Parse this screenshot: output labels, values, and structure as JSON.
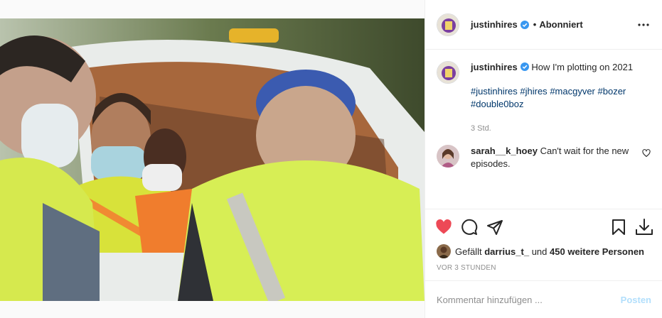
{
  "post": {
    "username": "justinhires",
    "follow_separator": "•",
    "follow_status": "Abonniert",
    "caption": "How I'm plotting on 2021",
    "hashtags": [
      "#justinhires",
      "#jhires",
      "#macgyver",
      "#bozer",
      "#double0boz"
    ],
    "caption_time": "3 Std."
  },
  "comment": {
    "username": "sarah__k_hoey",
    "text": "Can't wait for the new episodes."
  },
  "likes": {
    "prefix": "Gefällt",
    "user": "darrius_t_",
    "connector": "und",
    "others": "450 weitere Personen"
  },
  "timestamp": "VOR 3 STUNDEN",
  "add_comment": {
    "placeholder": "Kommentar hinzufügen ...",
    "post_label": "Posten"
  },
  "colors": {
    "like_red": "#ed4956",
    "verified_blue": "#3897f0",
    "hashtag": "#00376b",
    "post_disabled": "#b2dffc"
  },
  "icons": [
    "more-options-icon",
    "verified-icon",
    "heart-filled-icon",
    "comment-icon",
    "share-icon",
    "bookmark-icon",
    "download-icon",
    "comment-like-icon"
  ]
}
